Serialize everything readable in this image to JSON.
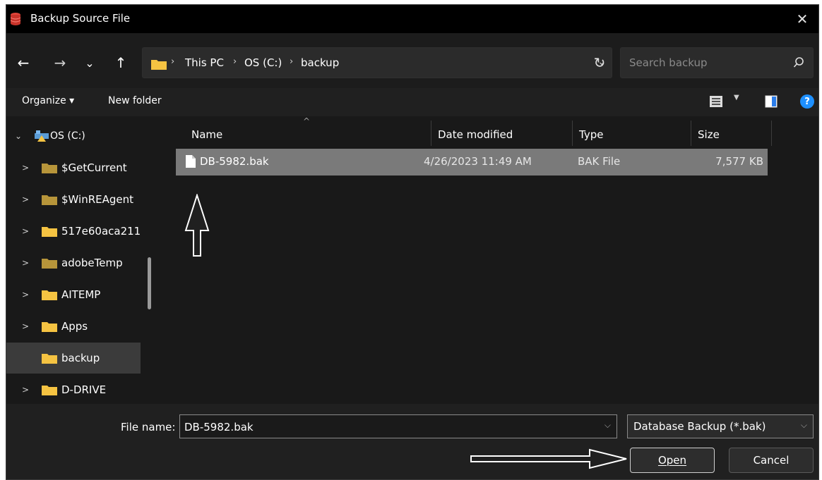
{
  "window": {
    "title": "Backup Source File",
    "close_glyph": "✕"
  },
  "nav": {
    "back_glyph": "←",
    "forward_glyph": "→",
    "recent_glyph": "⌄",
    "up_glyph": "↑",
    "breadcrumbs": [
      "This PC",
      "OS (C:)",
      "backup"
    ],
    "separator": "›",
    "dropdown_glyph": "⌄",
    "refresh_glyph": "↻"
  },
  "search": {
    "placeholder": "Search backup"
  },
  "toolbar": {
    "organize_label": "Organize ▾",
    "new_folder_label": "New folder",
    "help_glyph": "?"
  },
  "tree": {
    "root": {
      "label": "OS (C:)",
      "expanded": true
    },
    "items": [
      {
        "label": "$GetCurrent",
        "icon": "folder-dim-icon",
        "chevron": ">"
      },
      {
        "label": "$WinREAgent",
        "icon": "folder-dim-icon",
        "chevron": ">"
      },
      {
        "label": "517e60aca211",
        "icon": "folder-icon",
        "chevron": ">"
      },
      {
        "label": "adobeTemp",
        "icon": "folder-dim-icon",
        "chevron": ">"
      },
      {
        "label": "AITEMP",
        "icon": "folder-icon",
        "chevron": ">"
      },
      {
        "label": "Apps",
        "icon": "folder-icon",
        "chevron": ">"
      },
      {
        "label": "backup",
        "icon": "folder-icon",
        "chevron": "",
        "selected": true
      },
      {
        "label": "D-DRIVE",
        "icon": "folder-icon",
        "chevron": ">"
      }
    ]
  },
  "columns": {
    "name": "Name",
    "date": "Date modified",
    "type": "Type",
    "size": "Size",
    "sort_glyph": "^"
  },
  "files": [
    {
      "name": "DB-5982.bak",
      "date": "4/26/2023 11:49 AM",
      "type": "BAK File",
      "size": "7,577 KB",
      "selected": true
    }
  ],
  "footer": {
    "file_name_label": "File name:",
    "file_name_value": "DB-5982.bak",
    "file_type_value": "Database Backup (*.bak)",
    "open_label": "Open",
    "cancel_label": "Cancel",
    "dropdown_glyph": "⌵"
  },
  "colors": {
    "background": "#202020",
    "pane": "#191919",
    "selection": "#7a7a7a",
    "folder": "#f5c342",
    "help": "#1e90ff"
  }
}
